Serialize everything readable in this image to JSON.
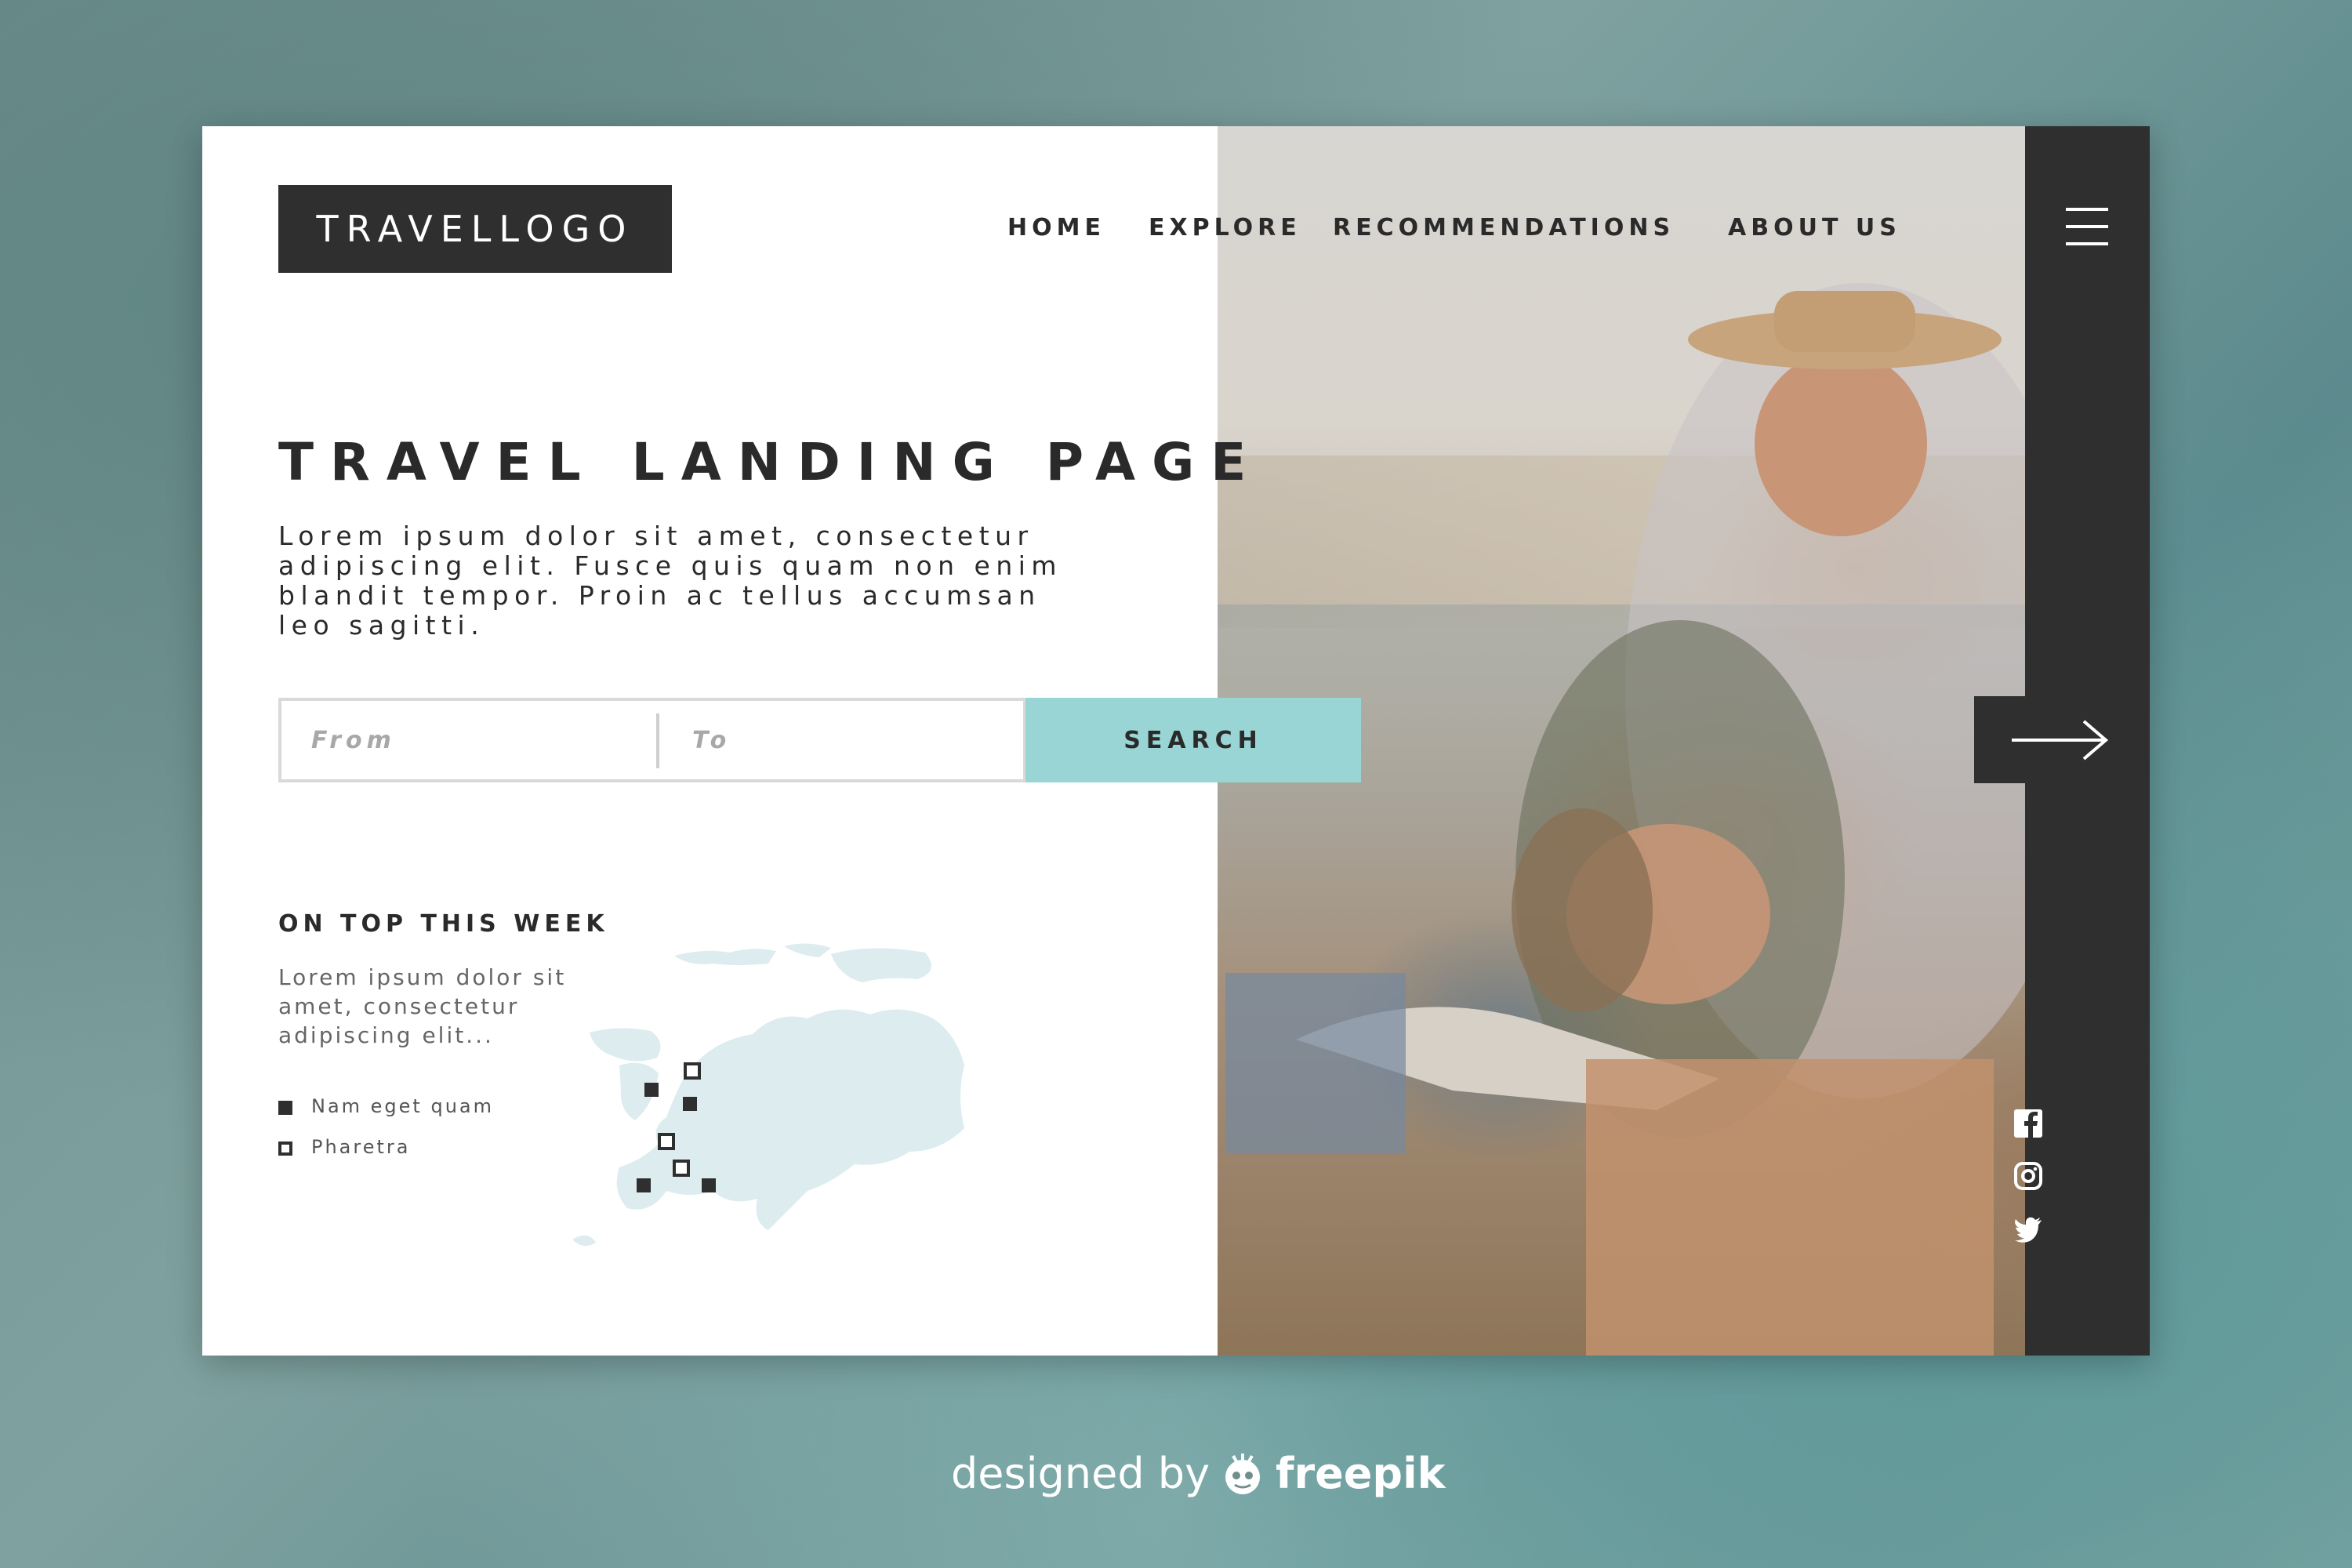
{
  "brand": {
    "logo_text": "TRAVELLOGO"
  },
  "nav": {
    "items": [
      "HOME",
      "EXPLORE",
      "RECOMMENDATIONS",
      "ABOUT US"
    ]
  },
  "hero": {
    "title": "TRAVEL LANDING PAGE",
    "description": "Lorem ipsum dolor sit amet, consectetur adipiscing elit. Fusce quis quam non enim blandit tempor. Proin ac tellus accumsan leo sagitti."
  },
  "search": {
    "from_placeholder": "From",
    "to_placeholder": "To",
    "button_label": "SEARCH"
  },
  "weekly": {
    "title": "ON TOP THIS WEEK",
    "description": "Lorem ipsum dolor sit amet, consectetur adipiscing elit...",
    "legend": [
      {
        "label": "Nam eget quam",
        "style": "filled"
      },
      {
        "label": "Pharetra",
        "style": "outline"
      }
    ]
  },
  "colors": {
    "dark": "#2f2f2f",
    "accent": "#99d5d5",
    "map": "#dcecef"
  },
  "icons": [
    "menu-icon",
    "arrow-right-icon",
    "facebook-icon",
    "instagram-icon",
    "twitter-icon",
    "freepik-logo-icon"
  ],
  "credit": {
    "prefix": "designed by",
    "brand": "freepik"
  }
}
